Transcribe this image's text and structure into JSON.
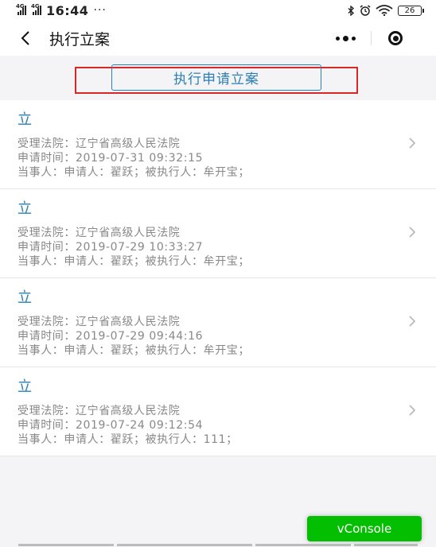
{
  "status_bar": {
    "network_1": "4G",
    "network_2": "4G",
    "time": "16:44",
    "dots": "···",
    "battery": "26"
  },
  "nav": {
    "title": "执行立案",
    "back_icon": "chevron-left-icon",
    "more_icon": "more-dots-icon",
    "close_icon": "target-close-icon"
  },
  "apply_button": {
    "label": "执行申请立案",
    "color": "#2b7fb4",
    "highlight_color": "#d9262b"
  },
  "cases": [
    {
      "status": "立",
      "court": "受理法院：辽宁省高级人民法院",
      "time": "申请时间：2019-07-31 09:32:15",
      "parties": "当事人：申请人：翟跃；被执行人：牟开宝；"
    },
    {
      "status": "立",
      "court": "受理法院：辽宁省高级人民法院",
      "time": "申请时间：2019-07-29 10:33:27",
      "parties": "当事人：申请人：翟跃；被执行人：牟开宝；"
    },
    {
      "status": "立",
      "court": "受理法院：辽宁省高级人民法院",
      "time": "申请时间：2019-07-29 09:44:16",
      "parties": "当事人：申请人：翟跃；被执行人：牟开宝；"
    },
    {
      "status": "立",
      "court": "受理法院：辽宁省高级人民法院",
      "time": "申请时间：2019-07-24 09:12:54",
      "parties": "当事人：申请人：翟跃；被执行人：111；"
    }
  ],
  "vconsole": {
    "label": "vConsole",
    "color": "#04be02"
  }
}
